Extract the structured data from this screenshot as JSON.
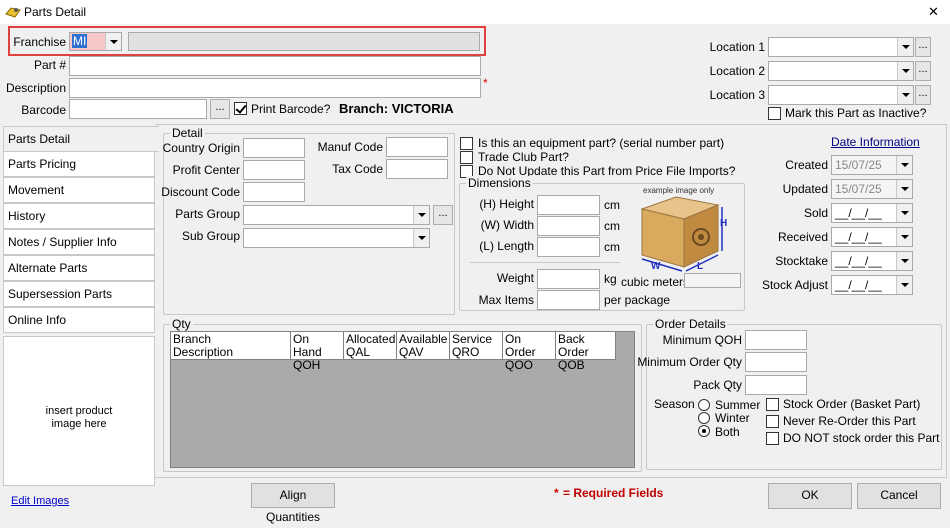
{
  "window": {
    "title": "Parts Detail",
    "close_glyph": "✕"
  },
  "header": {
    "franchise_label": "Franchise",
    "franchise_value": "MI",
    "part_label": "Part #",
    "description_label": "Description",
    "required_mark": "*",
    "barcode_label": "Barcode",
    "ellipsis": "...",
    "print_barcode_label": "Print Barcode?",
    "print_barcode_checked": true,
    "branch_text": "Branch: VICTORIA",
    "location1_label": "Location 1",
    "location2_label": "Location 2",
    "location3_label": "Location 3",
    "inactive_label": "Mark this Part as Inactive?",
    "highlight_color": "#e04040"
  },
  "nav": {
    "items": [
      "Parts Detail",
      "Parts Pricing",
      "Movement",
      "History",
      "Notes / Supplier Info",
      "Alternate Parts",
      "Supersession Parts",
      "Online Info"
    ],
    "image_placeholder_line1": "insert product",
    "image_placeholder_line2": "image here",
    "edit_images": "Edit Images"
  },
  "detail": {
    "group_title": "Detail",
    "country_origin": "Country Origin",
    "profit_center": "Profit Center",
    "discount_code": "Discount Code",
    "manuf_code": "Manuf Code",
    "tax_code": "Tax Code",
    "parts_group": "Parts Group",
    "sub_group": "Sub Group",
    "equipment_q": "Is this an equipment part? (serial number part)",
    "trade_club_q": "Trade Club Part?",
    "no_update_q": "Do Not Update this Part from Price File Imports?"
  },
  "dimensions": {
    "group_title": "Dimensions",
    "height": "(H) Height",
    "width": "(W) Width",
    "length": "(L) Length",
    "unit": "cm",
    "weight": "Weight",
    "weight_unit": "kg",
    "max_items": "Max Items",
    "per_package": "per package",
    "example_caption": "example image only",
    "cubic_meters": "cubic meters",
    "box_h": "H",
    "box_w": "W",
    "box_l": "L"
  },
  "dates": {
    "header": "Date Information",
    "created_label": "Created",
    "created_value": "15/07/25",
    "updated_label": "Updated",
    "updated_value": "15/07/25",
    "sold_label": "Sold",
    "received_label": "Received",
    "stocktake_label": "Stocktake",
    "stock_adjust_label": "Stock Adjust",
    "blank_date": "__/__/__"
  },
  "qty": {
    "group_title": "Qty",
    "columns": [
      {
        "l1": "Branch",
        "l2": "Description"
      },
      {
        "l1": "On Hand",
        "l2": "QOH"
      },
      {
        "l1": "Allocated",
        "l2": "QAL"
      },
      {
        "l1": "Available",
        "l2": "QAV"
      },
      {
        "l1": "Service",
        "l2": "QRO"
      },
      {
        "l1": "On Order",
        "l2": "QOO"
      },
      {
        "l1": "Back Order",
        "l2": "QOB"
      }
    ]
  },
  "order": {
    "group_title": "Order Details",
    "min_qoh": "Minimum QOH",
    "min_order_qty": "Minimum Order Qty",
    "pack_qty": "Pack Qty",
    "season": "Season",
    "summer": "Summer",
    "winter": "Winter",
    "both": "Both",
    "season_selected": "Both",
    "stock_order": "Stock Order (Basket Part)",
    "never_reorder": "Never Re-Order this Part",
    "do_not_stock": "DO NOT stock order this Part"
  },
  "footer": {
    "align_quantities": "Align Quantities",
    "required_star": "*",
    "required_text": "= Required Fields",
    "ok": "OK",
    "cancel": "Cancel"
  }
}
